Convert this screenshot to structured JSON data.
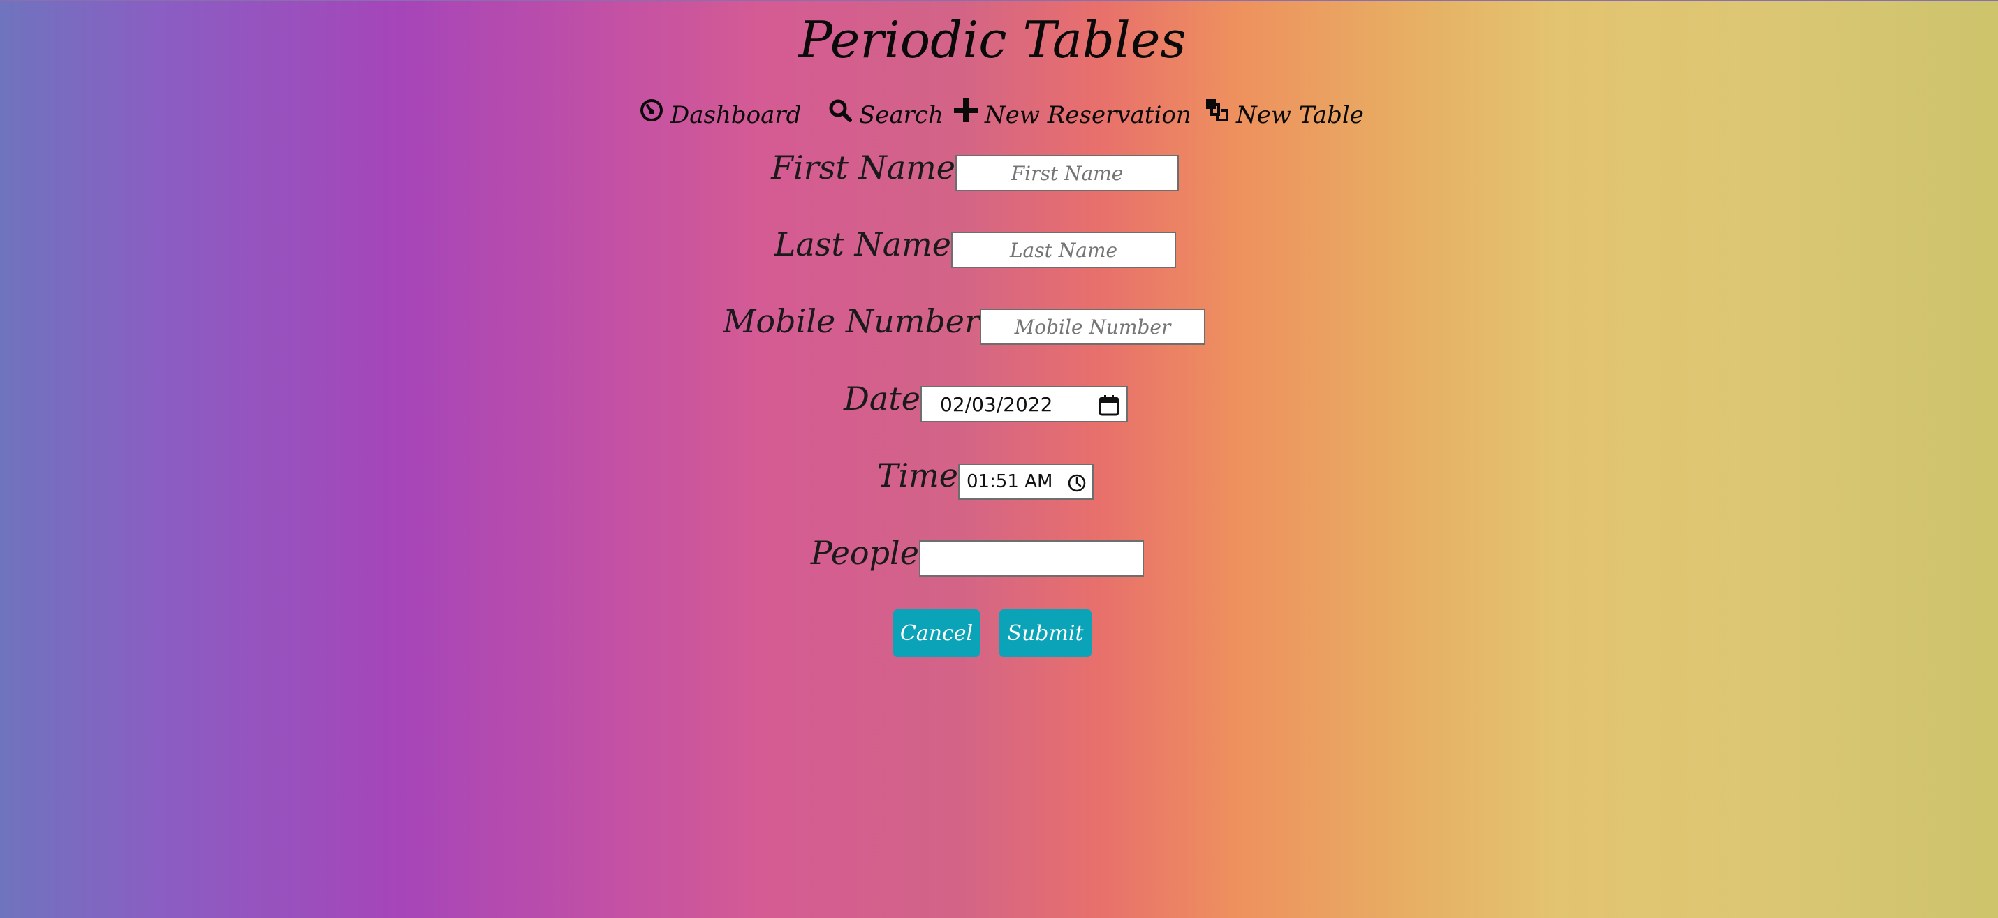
{
  "app": {
    "title": "Periodic Tables"
  },
  "nav": {
    "items": [
      {
        "label": "Dashboard",
        "icon": "dashboard-icon"
      },
      {
        "label": "Search",
        "icon": "search-icon"
      },
      {
        "label": "New Reservation",
        "icon": "plus-icon"
      },
      {
        "label": "New Table",
        "icon": "layers-icon"
      }
    ]
  },
  "form": {
    "first_name": {
      "label": "First Name",
      "placeholder": "First Name",
      "value": ""
    },
    "last_name": {
      "label": "Last Name",
      "placeholder": "Last Name",
      "value": ""
    },
    "mobile_number": {
      "label": "Mobile Number",
      "placeholder": "Mobile Number",
      "value": ""
    },
    "date": {
      "label": "Date",
      "value": "02/03/2022",
      "icon": "calendar-icon"
    },
    "time": {
      "label": "Time",
      "value": "01:51 AM",
      "icon": "clock-icon"
    },
    "people": {
      "label": "People",
      "value": ""
    },
    "cancel_label": "Cancel",
    "submit_label": "Submit"
  },
  "colors": {
    "button": "#0ba3b8",
    "gradient": [
      "#6f74be",
      "#a645b9",
      "#d45b94",
      "#e8706c",
      "#e7b064",
      "#cdc46c"
    ]
  }
}
